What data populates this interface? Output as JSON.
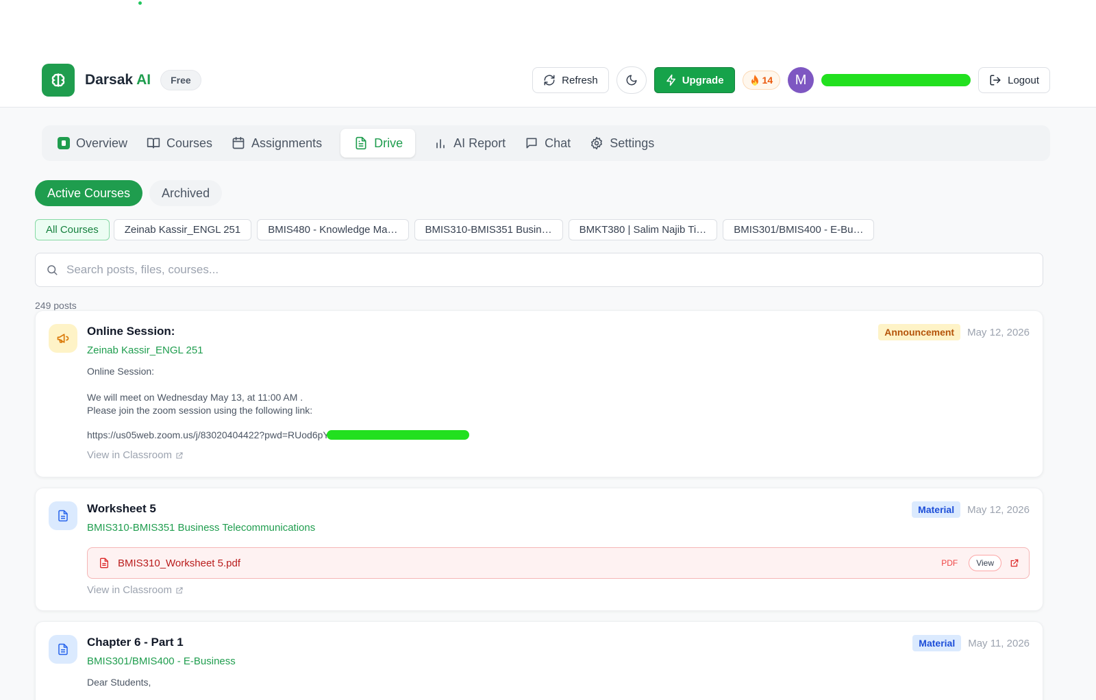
{
  "app": {
    "name": "Darsak",
    "name_accent": "AI",
    "plan": "Free"
  },
  "header": {
    "refresh_label": "Refresh",
    "upgrade_label": "Upgrade",
    "streak": "14",
    "avatar_initial": "M",
    "logout_label": "Logout"
  },
  "nav": {
    "tabs": [
      {
        "label": "Overview",
        "icon": "overview-icon"
      },
      {
        "label": "Courses",
        "icon": "book-icon"
      },
      {
        "label": "Assignments",
        "icon": "calendar-icon"
      },
      {
        "label": "Drive",
        "icon": "file-icon",
        "active": true
      },
      {
        "label": "AI Report",
        "icon": "bar-chart-icon"
      },
      {
        "label": "Chat",
        "icon": "chat-icon"
      },
      {
        "label": "Settings",
        "icon": "gear-icon"
      }
    ]
  },
  "filters": {
    "segments": [
      {
        "label": "Active Courses",
        "active": true
      },
      {
        "label": "Archived",
        "active": false
      }
    ],
    "courses": [
      "All Courses",
      "Zeinab Kassir_ENGL 251",
      "BMIS480 - Knowledge Ma…",
      "BMIS310-BMIS351 Busin…",
      "BMKT380 | Salim Najib Ti…",
      "BMIS301/BMIS400 - E-Bu…"
    ]
  },
  "search": {
    "placeholder": "Search posts, files, courses..."
  },
  "posts_count": "249 posts",
  "posts": [
    {
      "type": "Announcement",
      "title": "Online Session:",
      "course": "Zeinab Kassir_ENGL 251",
      "date": "May 12, 2026",
      "body": [
        "Online Session:",
        "We will meet on Wednesday May 13, at 11:00 AM .",
        "Please join the zoom session using the following link:"
      ],
      "link": "https://us05web.zoom.us/j/83020404422?pwd=RUod6pY",
      "view_label": "View in Classroom"
    },
    {
      "type": "Material",
      "title": "Worksheet 5",
      "course": "BMIS310-BMIS351 Business Telecommunications",
      "date": "May 12, 2026",
      "file": {
        "name": "BMIS310_Worksheet 5.pdf",
        "kind": "PDF",
        "view_label": "View"
      },
      "view_label": "View in Classroom"
    },
    {
      "type": "Material",
      "title": "Chapter 6 - Part 1",
      "course": "BMIS301/BMIS400 - E-Business",
      "date": "May 11, 2026",
      "body": [
        "Dear Students,"
      ]
    }
  ],
  "colors": {
    "brand_green": "#1f9d4e",
    "announcement": "#b45309",
    "material": "#1d4ed8",
    "pdf_red": "#b91c1c"
  }
}
